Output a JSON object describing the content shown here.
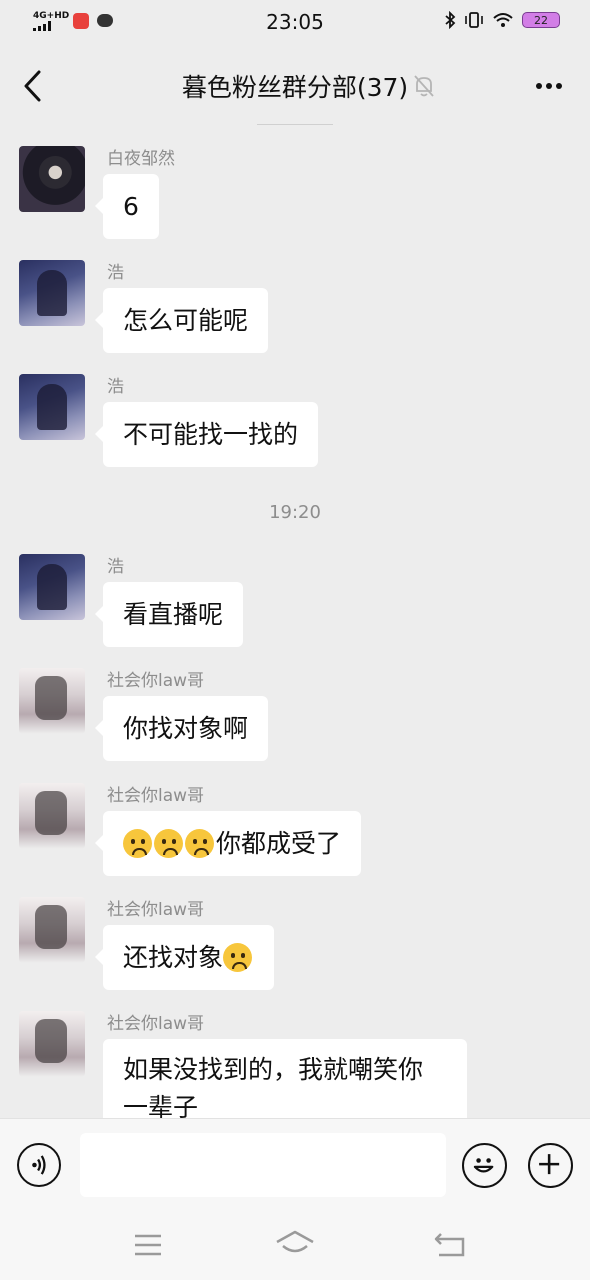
{
  "status_bar": {
    "network": "4G+HD",
    "time": "23:05",
    "battery": "22",
    "icons": [
      "signal-icon",
      "app-notification-icon",
      "message-icon",
      "bluetooth-icon",
      "vibrate-icon",
      "wifi-icon",
      "battery-icon"
    ]
  },
  "header": {
    "title": "暮色粉丝群分部(37)",
    "icons": [
      "back-icon",
      "mute-bell-icon",
      "more-icon"
    ]
  },
  "messages": [
    {
      "sender": "白夜邹然",
      "text": "6",
      "avatar": "avatar-photo"
    },
    {
      "sender": "浩",
      "text": "怎么可能呢",
      "avatar": "avatar-anime"
    },
    {
      "sender": "浩",
      "text": "不可能找一找的",
      "avatar": "avatar-anime"
    },
    {
      "sender": "浩",
      "text": "看直播呢",
      "avatar": "avatar-anime"
    },
    {
      "sender": "社会你law哥",
      "text": "你找对象啊",
      "avatar": "avatar-pink"
    },
    {
      "sender": "社会你law哥",
      "text": "你都成受了",
      "emoji_prefix": 3,
      "avatar": "avatar-pink"
    },
    {
      "sender": "社会你law哥",
      "text": "还找对象",
      "emoji_suffix": 1,
      "avatar": "avatar-pink"
    },
    {
      "sender": "社会你law哥",
      "text": "如果没找到的，我就嘲笑你一辈子",
      "avatar": "avatar-pink"
    }
  ],
  "timestamp": "19:20",
  "input_bar": {
    "placeholder": "",
    "icons": [
      "voice-icon",
      "emoji-icon",
      "plus-icon"
    ]
  },
  "nav_bar": {
    "icons": [
      "menu-icon",
      "home-icon",
      "back-nav-icon"
    ]
  }
}
